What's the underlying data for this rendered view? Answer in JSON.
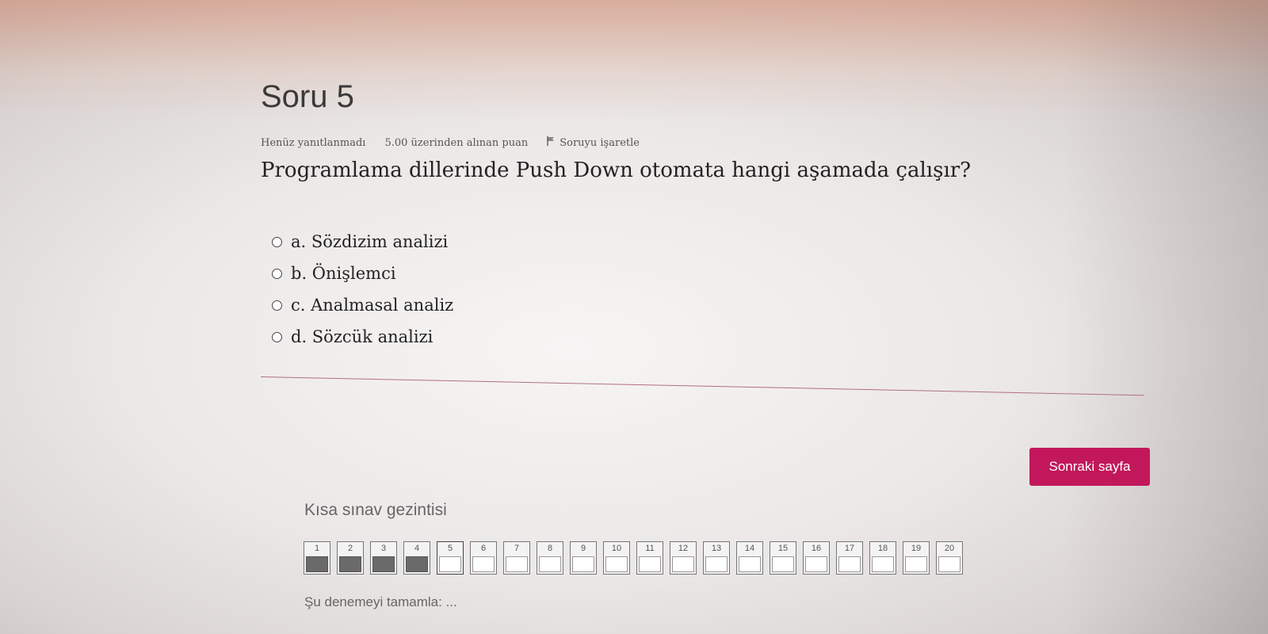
{
  "question": {
    "title": "Soru 5",
    "status": "Henüz yanıtlanmadı",
    "points": "5.00 üzerinden alınan puan",
    "flag_label": "Soruyu işaretle",
    "text": "Programlama dillerinde Push Down otomata hangi aşamada çalışır?",
    "answers": [
      "a. Sözdizim analizi",
      "b. Önişlemci",
      "c. Analmasal analiz",
      "d. Sözcük analizi"
    ]
  },
  "next_button": "Sonraki sayfa",
  "navigation": {
    "title": "Kısa sınav gezintisi",
    "items": [
      {
        "n": "1",
        "answered": true
      },
      {
        "n": "2",
        "answered": true
      },
      {
        "n": "3",
        "answered": true
      },
      {
        "n": "4",
        "answered": true
      },
      {
        "n": "5",
        "answered": false,
        "current": true
      },
      {
        "n": "6",
        "answered": false
      },
      {
        "n": "7",
        "answered": false
      },
      {
        "n": "8",
        "answered": false
      },
      {
        "n": "9",
        "answered": false
      },
      {
        "n": "10",
        "answered": false
      },
      {
        "n": "11",
        "answered": false
      },
      {
        "n": "12",
        "answered": false
      },
      {
        "n": "13",
        "answered": false
      },
      {
        "n": "14",
        "answered": false
      },
      {
        "n": "15",
        "answered": false
      },
      {
        "n": "16",
        "answered": false
      },
      {
        "n": "17",
        "answered": false
      },
      {
        "n": "18",
        "answered": false
      },
      {
        "n": "19",
        "answered": false
      },
      {
        "n": "20",
        "answered": false
      }
    ],
    "finish_link": "Şu denemeyi tamamla: ..."
  },
  "colors": {
    "accent": "#c2185b"
  }
}
